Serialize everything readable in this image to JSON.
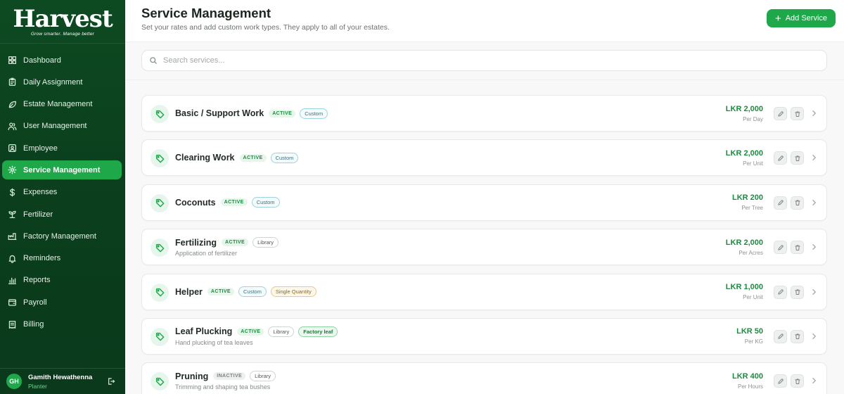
{
  "brand": {
    "name": "Harvest",
    "tagline": "Grow smarter. Manage better"
  },
  "sidebar": {
    "items": [
      {
        "label": "Dashboard",
        "icon": "grid-icon",
        "active": false
      },
      {
        "label": "Daily Assignment",
        "icon": "clipboard-icon",
        "active": false
      },
      {
        "label": "Estate Management",
        "icon": "leaf-icon",
        "active": false
      },
      {
        "label": "User Management",
        "icon": "users-icon",
        "active": false
      },
      {
        "label": "Employee",
        "icon": "id-card-icon",
        "active": false
      },
      {
        "label": "Service Management",
        "icon": "gear-icon",
        "active": true
      },
      {
        "label": "Expenses",
        "icon": "dollar-icon",
        "active": false
      },
      {
        "label": "Fertilizer",
        "icon": "sprout-icon",
        "active": false
      },
      {
        "label": "Factory Management",
        "icon": "factory-icon",
        "active": false
      },
      {
        "label": "Reminders",
        "icon": "bell-icon",
        "active": false
      },
      {
        "label": "Reports",
        "icon": "bar-chart-icon",
        "active": false
      },
      {
        "label": "Payroll",
        "icon": "wallet-icon",
        "active": false
      },
      {
        "label": "Billing",
        "icon": "receipt-icon",
        "active": false
      }
    ]
  },
  "user": {
    "initials": "GH",
    "name": "Gamith Hewathenna",
    "role": "Planter"
  },
  "header": {
    "title": "Service Management",
    "subtitle": "Set your rates and add custom work types. They apply to all of your estates.",
    "add_label": "Add Service"
  },
  "search": {
    "placeholder": "Search services..."
  },
  "services": [
    {
      "name": "Basic / Support Work",
      "status": "ACTIVE",
      "chips": [
        "Custom"
      ],
      "desc": "",
      "price": "LKR 2,000",
      "unit": "Per Day"
    },
    {
      "name": "Clearing Work",
      "status": "ACTIVE",
      "chips": [
        "Custom"
      ],
      "desc": "",
      "price": "LKR 2,000",
      "unit": "Per Unit"
    },
    {
      "name": "Coconuts",
      "status": "ACTIVE",
      "chips": [
        "Custom"
      ],
      "desc": "",
      "price": "LKR 200",
      "unit": "Per Tree"
    },
    {
      "name": "Fertilizing",
      "status": "ACTIVE",
      "chips": [
        "Library"
      ],
      "desc": "Application of fertilizer",
      "price": "LKR 2,000",
      "unit": "Per Acres"
    },
    {
      "name": "Helper",
      "status": "ACTIVE",
      "chips": [
        "Custom",
        "Single Quantity"
      ],
      "desc": "",
      "price": "LKR 1,000",
      "unit": "Per Unit"
    },
    {
      "name": "Leaf Plucking",
      "status": "ACTIVE",
      "chips": [
        "Library",
        "Factory leaf"
      ],
      "desc": "Hand plucking of tea leaves",
      "price": "LKR 50",
      "unit": "Per KG"
    },
    {
      "name": "Pruning",
      "status": "INACTIVE",
      "chips": [
        "Library"
      ],
      "desc": "Trimming and shaping tea bushes",
      "price": "LKR 400",
      "unit": "Per Hours"
    }
  ],
  "colors": {
    "brand_green": "#1fa84a",
    "sidebar_dark": "#0b3f1d",
    "price_green": "#1a8c3e"
  }
}
